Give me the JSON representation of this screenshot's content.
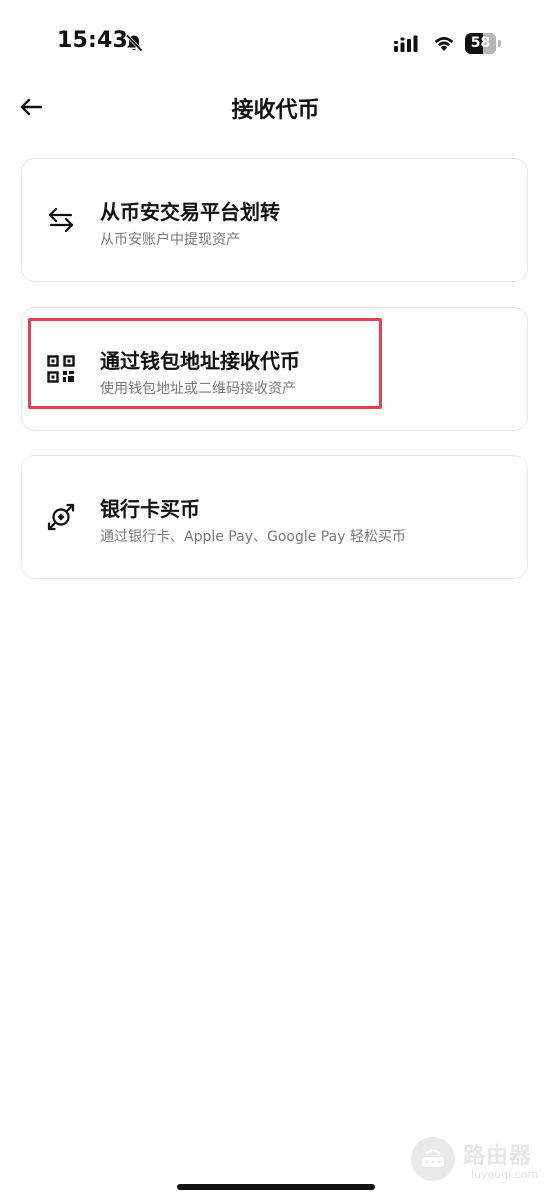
{
  "status_bar": {
    "time": "15:43",
    "battery_level": "58",
    "battery_fraction": 0.58,
    "icons": [
      "bell-slash-icon",
      "signal-icon",
      "wifi-icon",
      "battery-icon"
    ]
  },
  "header": {
    "title": "接收代币",
    "back_icon": "arrow-left-icon"
  },
  "options": [
    {
      "icon": "transfer-arrows-icon",
      "title": "从币安交易平台划转",
      "subtitle": "从币安账户中提现资产"
    },
    {
      "icon": "qr-code-icon",
      "title": "通过钱包地址接收代币",
      "subtitle": "使用钱包地址或二维码接收资产",
      "highlighted": true
    },
    {
      "icon": "buy-crypto-icon",
      "title": "银行卡买币",
      "subtitle": "通过银行卡、Apple Pay、Google Pay 轻松买币"
    }
  ],
  "watermark": {
    "text": "路由器",
    "url": "luyouqi.com"
  },
  "colors": {
    "highlight": "#e8404f",
    "text_primary": "#111111",
    "text_secondary": "#7a7a7a",
    "card_border": "#e8e8e8"
  }
}
